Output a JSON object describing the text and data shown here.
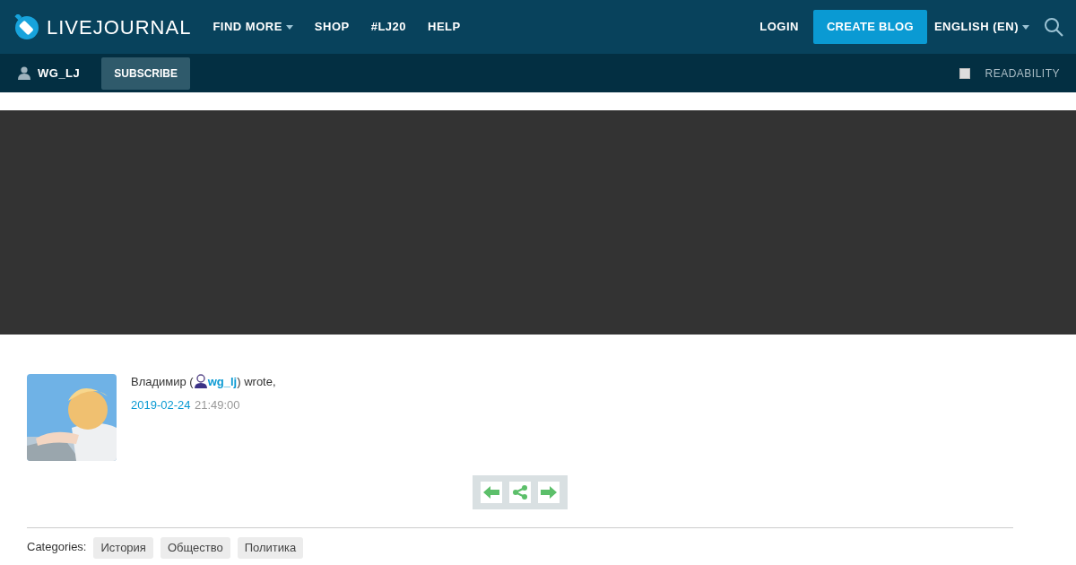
{
  "header": {
    "logo": "LIVEJOURNAL",
    "nav": [
      {
        "label": "FIND MORE",
        "dropdown": true
      },
      {
        "label": "SHOP",
        "dropdown": false
      },
      {
        "label": "#LJ20",
        "dropdown": false
      },
      {
        "label": "HELP",
        "dropdown": false
      }
    ],
    "login": "LOGIN",
    "create_blog": "CREATE BLOG",
    "language": "ENGLISH (EN)"
  },
  "subbar": {
    "user": "WG_LJ",
    "subscribe": "SUBSCRIBE",
    "readability": {
      "label": "READABILITY",
      "checked": false
    }
  },
  "post": {
    "author_name": "Владимир (",
    "username": "wg_lj",
    "wrote": ") wrote,",
    "date": "2019-02-24",
    "time": "21:49:00",
    "categories_label": "Categories:",
    "categories": [
      "История",
      "Общество",
      "Политика"
    ]
  }
}
